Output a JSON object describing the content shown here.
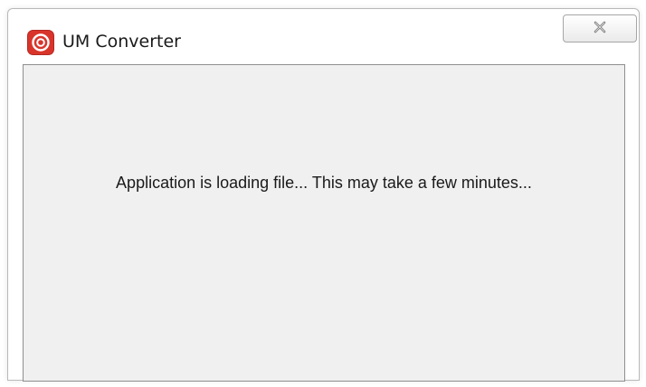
{
  "window": {
    "title": "UM Converter",
    "icon": "um-converter-app-icon",
    "close_icon": "close-x-icon",
    "accent_color": "#d9342b"
  },
  "content": {
    "message": "Application is loading file...  This may take a few minutes..."
  }
}
